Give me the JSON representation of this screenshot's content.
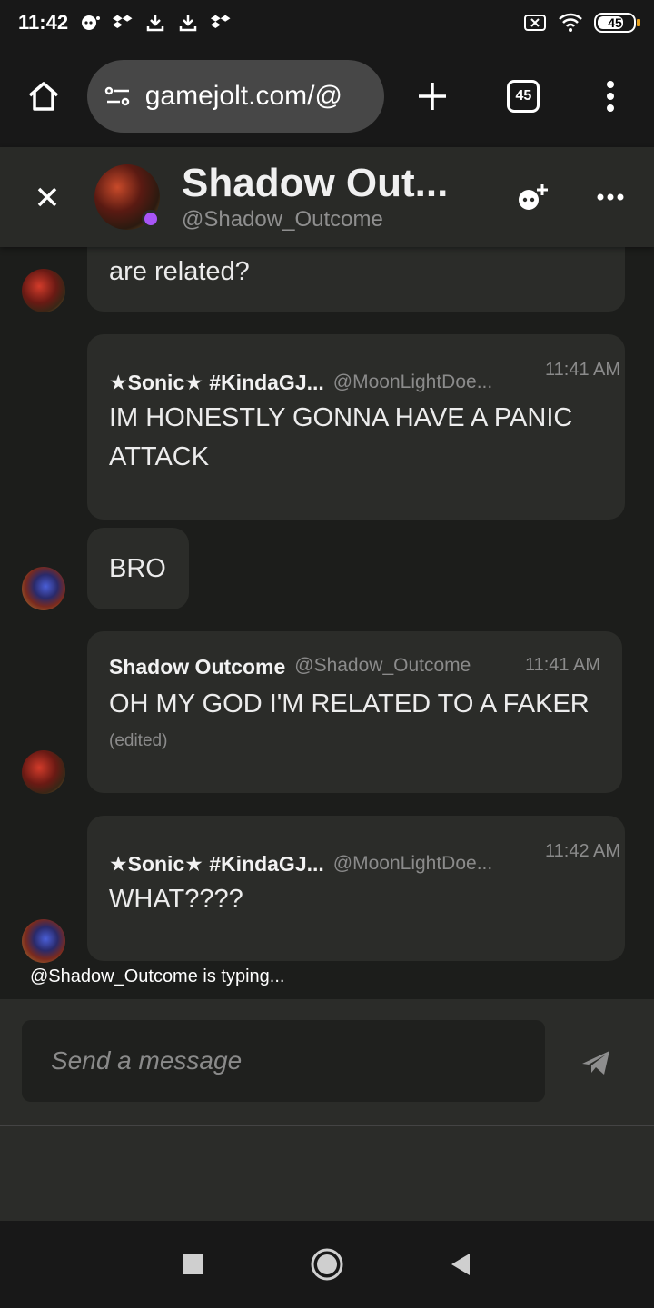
{
  "status_bar": {
    "time": "11:42",
    "battery": "45"
  },
  "browser": {
    "url": "gamejolt.com/@",
    "tab_count": "45"
  },
  "chat": {
    "title": "Shadow Out...",
    "handle": "@Shadow_Outcome",
    "status_color": "#a855f7"
  },
  "messages": [
    {
      "text": "are related?"
    },
    {
      "name": "★Sonic★ #KindaGJ...",
      "handle": "@MoonLightDoe...",
      "time": "11:41 AM",
      "text": "IM HONESTLY GONNA HAVE A PANIC ATTACK"
    },
    {
      "text": "BRO"
    },
    {
      "name": "Shadow Outcome",
      "handle": "@Shadow_Outcome",
      "time": "11:41 AM",
      "text": "OH MY GOD I'M RELATED TO A FAKER",
      "edited": "(edited)"
    },
    {
      "name": "★Sonic★ #KindaGJ...",
      "handle": "@MoonLightDoe...",
      "time": "11:42 AM",
      "text": "WHAT????"
    }
  ],
  "typing_indicator": "@Shadow_Outcome is typing...",
  "composer": {
    "placeholder": "Send a message"
  }
}
